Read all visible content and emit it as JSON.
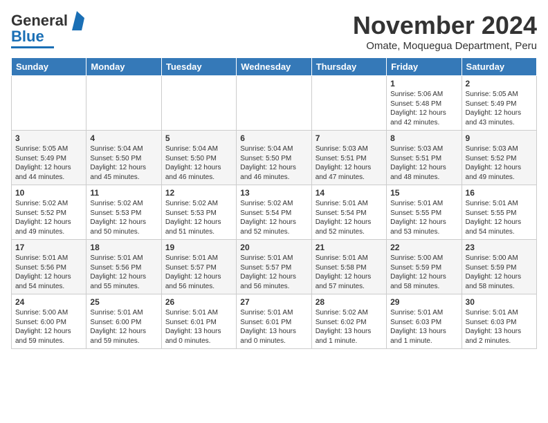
{
  "header": {
    "logo_general": "General",
    "logo_blue": "Blue",
    "month_title": "November 2024",
    "subtitle": "Omate, Moquegua Department, Peru"
  },
  "days_of_week": [
    "Sunday",
    "Monday",
    "Tuesday",
    "Wednesday",
    "Thursday",
    "Friday",
    "Saturday"
  ],
  "weeks": [
    [
      {
        "day": "",
        "info": ""
      },
      {
        "day": "",
        "info": ""
      },
      {
        "day": "",
        "info": ""
      },
      {
        "day": "",
        "info": ""
      },
      {
        "day": "",
        "info": ""
      },
      {
        "day": "1",
        "info": "Sunrise: 5:06 AM\nSunset: 5:48 PM\nDaylight: 12 hours\nand 42 minutes."
      },
      {
        "day": "2",
        "info": "Sunrise: 5:05 AM\nSunset: 5:49 PM\nDaylight: 12 hours\nand 43 minutes."
      }
    ],
    [
      {
        "day": "3",
        "info": "Sunrise: 5:05 AM\nSunset: 5:49 PM\nDaylight: 12 hours\nand 44 minutes."
      },
      {
        "day": "4",
        "info": "Sunrise: 5:04 AM\nSunset: 5:50 PM\nDaylight: 12 hours\nand 45 minutes."
      },
      {
        "day": "5",
        "info": "Sunrise: 5:04 AM\nSunset: 5:50 PM\nDaylight: 12 hours\nand 46 minutes."
      },
      {
        "day": "6",
        "info": "Sunrise: 5:04 AM\nSunset: 5:50 PM\nDaylight: 12 hours\nand 46 minutes."
      },
      {
        "day": "7",
        "info": "Sunrise: 5:03 AM\nSunset: 5:51 PM\nDaylight: 12 hours\nand 47 minutes."
      },
      {
        "day": "8",
        "info": "Sunrise: 5:03 AM\nSunset: 5:51 PM\nDaylight: 12 hours\nand 48 minutes."
      },
      {
        "day": "9",
        "info": "Sunrise: 5:03 AM\nSunset: 5:52 PM\nDaylight: 12 hours\nand 49 minutes."
      }
    ],
    [
      {
        "day": "10",
        "info": "Sunrise: 5:02 AM\nSunset: 5:52 PM\nDaylight: 12 hours\nand 49 minutes."
      },
      {
        "day": "11",
        "info": "Sunrise: 5:02 AM\nSunset: 5:53 PM\nDaylight: 12 hours\nand 50 minutes."
      },
      {
        "day": "12",
        "info": "Sunrise: 5:02 AM\nSunset: 5:53 PM\nDaylight: 12 hours\nand 51 minutes."
      },
      {
        "day": "13",
        "info": "Sunrise: 5:02 AM\nSunset: 5:54 PM\nDaylight: 12 hours\nand 52 minutes."
      },
      {
        "day": "14",
        "info": "Sunrise: 5:01 AM\nSunset: 5:54 PM\nDaylight: 12 hours\nand 52 minutes."
      },
      {
        "day": "15",
        "info": "Sunrise: 5:01 AM\nSunset: 5:55 PM\nDaylight: 12 hours\nand 53 minutes."
      },
      {
        "day": "16",
        "info": "Sunrise: 5:01 AM\nSunset: 5:55 PM\nDaylight: 12 hours\nand 54 minutes."
      }
    ],
    [
      {
        "day": "17",
        "info": "Sunrise: 5:01 AM\nSunset: 5:56 PM\nDaylight: 12 hours\nand 54 minutes."
      },
      {
        "day": "18",
        "info": "Sunrise: 5:01 AM\nSunset: 5:56 PM\nDaylight: 12 hours\nand 55 minutes."
      },
      {
        "day": "19",
        "info": "Sunrise: 5:01 AM\nSunset: 5:57 PM\nDaylight: 12 hours\nand 56 minutes."
      },
      {
        "day": "20",
        "info": "Sunrise: 5:01 AM\nSunset: 5:57 PM\nDaylight: 12 hours\nand 56 minutes."
      },
      {
        "day": "21",
        "info": "Sunrise: 5:01 AM\nSunset: 5:58 PM\nDaylight: 12 hours\nand 57 minutes."
      },
      {
        "day": "22",
        "info": "Sunrise: 5:00 AM\nSunset: 5:59 PM\nDaylight: 12 hours\nand 58 minutes."
      },
      {
        "day": "23",
        "info": "Sunrise: 5:00 AM\nSunset: 5:59 PM\nDaylight: 12 hours\nand 58 minutes."
      }
    ],
    [
      {
        "day": "24",
        "info": "Sunrise: 5:00 AM\nSunset: 6:00 PM\nDaylight: 12 hours\nand 59 minutes."
      },
      {
        "day": "25",
        "info": "Sunrise: 5:01 AM\nSunset: 6:00 PM\nDaylight: 12 hours\nand 59 minutes."
      },
      {
        "day": "26",
        "info": "Sunrise: 5:01 AM\nSunset: 6:01 PM\nDaylight: 13 hours\nand 0 minutes."
      },
      {
        "day": "27",
        "info": "Sunrise: 5:01 AM\nSunset: 6:01 PM\nDaylight: 13 hours\nand 0 minutes."
      },
      {
        "day": "28",
        "info": "Sunrise: 5:02 AM\nSunset: 6:02 PM\nDaylight: 13 hours\nand 1 minute."
      },
      {
        "day": "29",
        "info": "Sunrise: 5:01 AM\nSunset: 6:03 PM\nDaylight: 13 hours\nand 1 minute."
      },
      {
        "day": "30",
        "info": "Sunrise: 5:01 AM\nSunset: 6:03 PM\nDaylight: 13 hours\nand 2 minutes."
      }
    ]
  ]
}
